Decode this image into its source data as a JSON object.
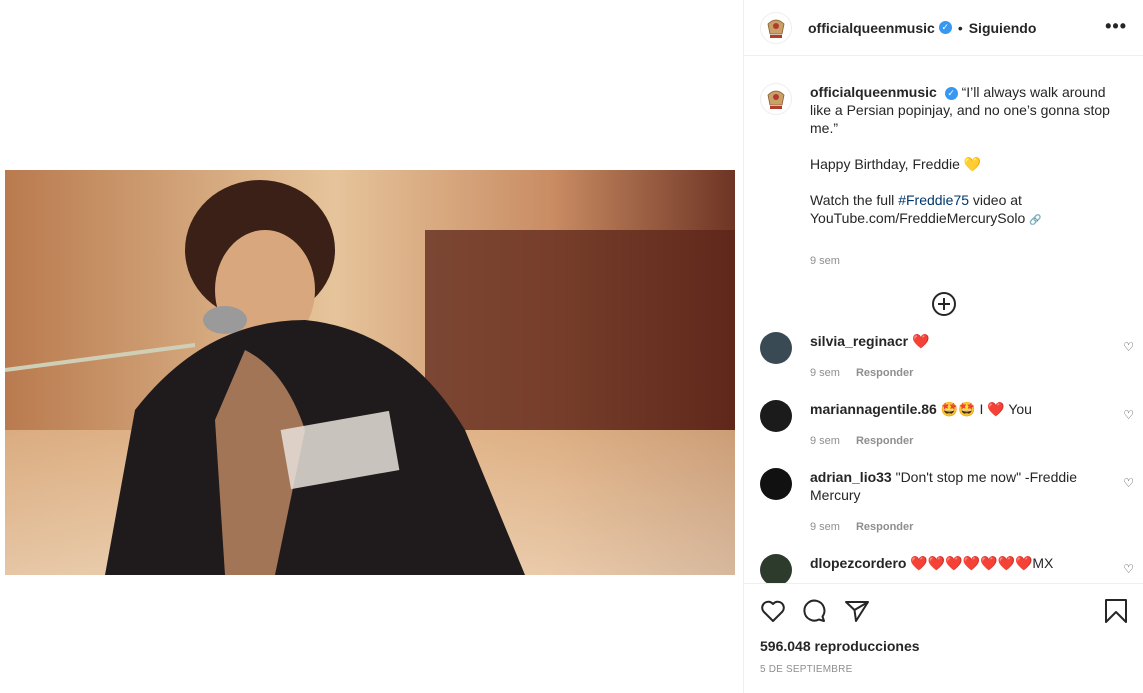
{
  "header": {
    "username": "officialqueenmusic",
    "separator": "•",
    "follow_status": "Siguiendo",
    "more_label": "•••"
  },
  "caption": {
    "username": "officialqueenmusic",
    "line1": "“I’ll always walk around like a Persian popinjay, and no one’s gonna stop me.”",
    "line2": "Happy Birthday, Freddie",
    "line2_emoji": "💛",
    "line3_prefix": "Watch the full ",
    "hashtag": "#Freddie75",
    "line3_suffix": " video at YouTube.com/FreddieMercurySolo",
    "link_emoji": "🔗",
    "time": "9 sem"
  },
  "comments": [
    {
      "username": "silvia_reginacr",
      "text": "❤️",
      "time": "9 sem",
      "reply": "Responder"
    },
    {
      "username": "mariannagentile.86",
      "text": "🤩🤩 I ❤️ You",
      "time": "9 sem",
      "reply": "Responder"
    },
    {
      "username": "adrian_lio33",
      "text": "\"Don't stop me now\" -Freddie Mercury",
      "time": "9 sem",
      "reply": "Responder"
    },
    {
      "username": "dlopezcordero",
      "text": "❤️❤️❤️❤️❤️❤️❤️MX",
      "time": "",
      "reply": ""
    }
  ],
  "footer": {
    "views": "596.048 reproducciones",
    "date": "5 DE SEPTIEMBRE"
  },
  "icons": {
    "like": "heart-icon",
    "comment": "comment-icon",
    "share": "send-icon",
    "save": "bookmark-icon",
    "load_more": "plus-circle-icon"
  },
  "colors": {
    "verified": "#3897f0",
    "hashtag": "#00376b",
    "muted": "#8e8e8e",
    "heart": "#ed4956"
  }
}
